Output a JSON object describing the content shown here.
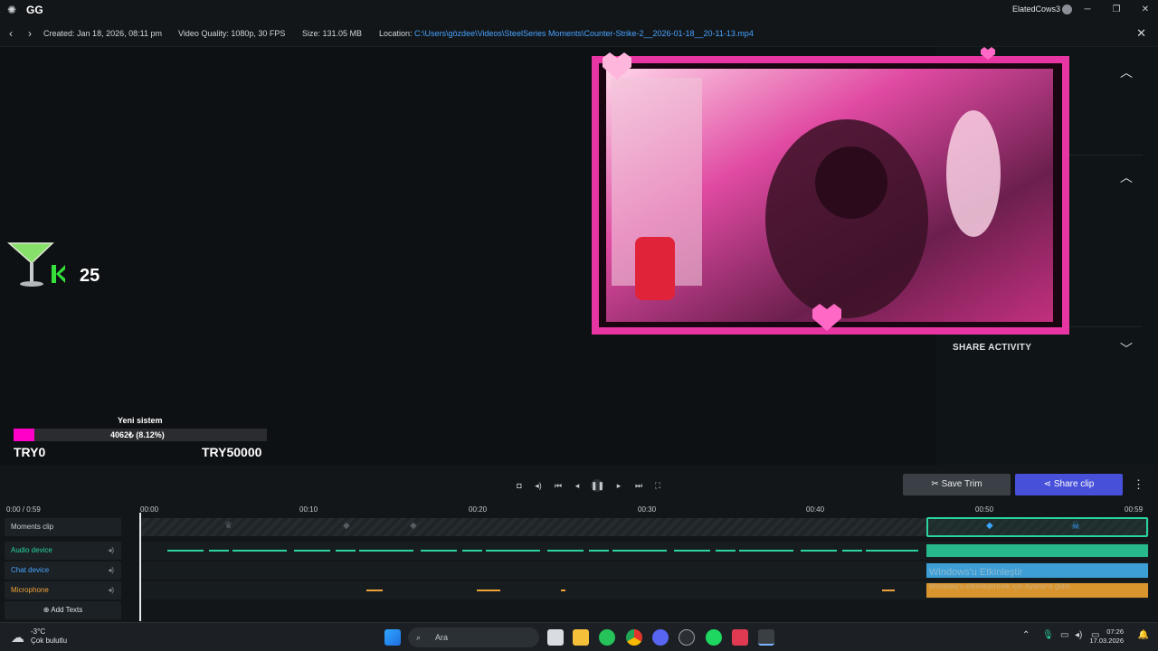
{
  "app": {
    "title": "GG",
    "user": "ElatedCows3"
  },
  "info": {
    "created_label": "Created:",
    "created": "Jan 18, 2026, 08:11 pm",
    "quality_label": "Video Quality:",
    "quality": "1080p, 30 FPS",
    "size_label": "Size:",
    "size": "131.05 MB",
    "location_label": "Location:",
    "location": "C:\\Users\\gözdee\\Videos\\SteelSeries Moments\\Counter-Strike-2__2026-01-18__20-11-13.mp4"
  },
  "overlay": {
    "kills": "25",
    "goal_title": "Yeni sistem",
    "goal_progress": "4062₺ (8.12%)",
    "goal_fraction": 0.0812,
    "goal_min": "TRY0",
    "goal_max": "TRY50000"
  },
  "side": {
    "share_activity": "SHARE ACTIVITY"
  },
  "actions": {
    "save_trim": "Save Trim",
    "share_clip": "Share clip"
  },
  "timeline": {
    "time": "0:00 / 0:59",
    "ticks": [
      "00:00",
      "00:10",
      "00:20",
      "00:30",
      "00:40",
      "00:50",
      "00:59"
    ],
    "tracks": [
      {
        "label": "Moments clip",
        "color": "#c9ced2"
      },
      {
        "label": "Audio device",
        "color": "#2ad3a0"
      },
      {
        "label": "Chat device",
        "color": "#4aa3ff"
      },
      {
        "label": "Microphone",
        "color": "#f0a23a"
      }
    ],
    "add_texts": "Add Texts"
  },
  "watermark": {
    "line1": "Windows'u Etkinleştir",
    "line2": "Windows'u etkinleştirmek için Ayarlar'a gidin"
  },
  "taskbar": {
    "temp": "-3°C",
    "weather": "Çok bulutlu",
    "search_placeholder": "Ara",
    "time": "07:26",
    "date": "17.03.2026"
  }
}
